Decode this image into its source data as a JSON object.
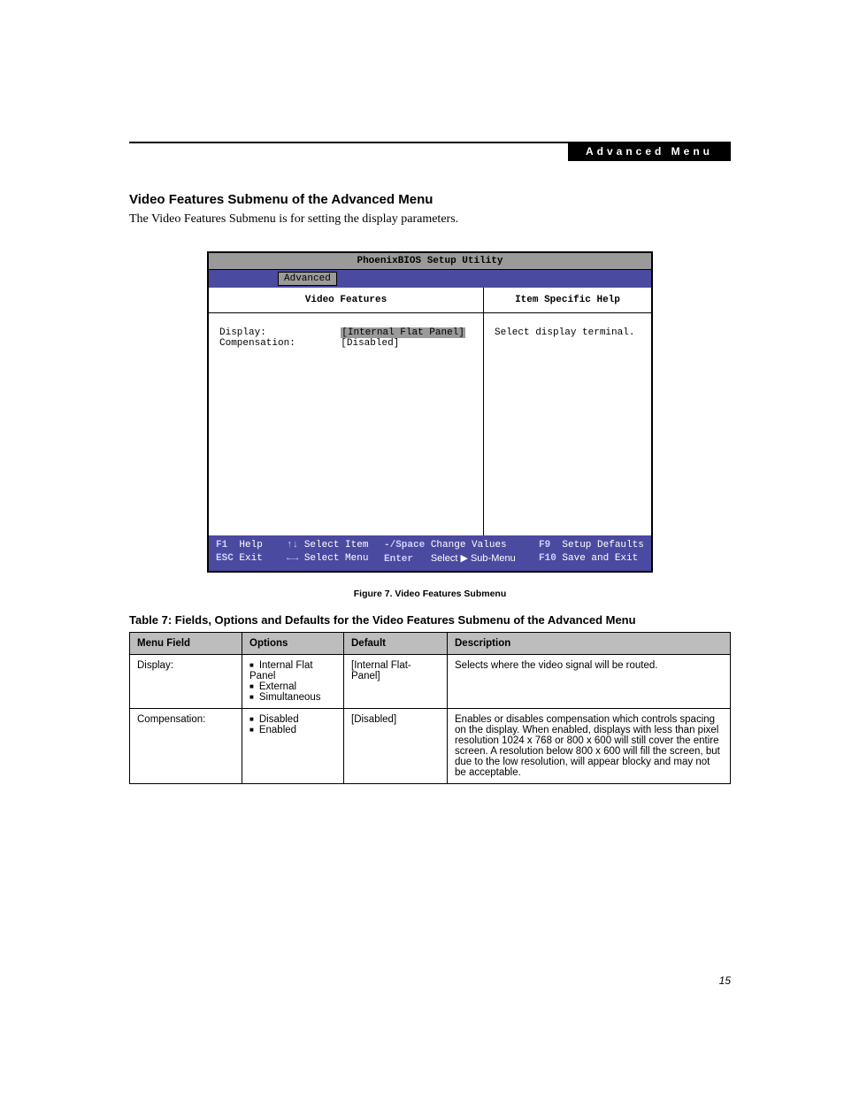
{
  "header": {
    "banner": "Advanced Menu"
  },
  "section": {
    "heading": "Video Features Submenu of the Advanced Menu",
    "intro": "The Video Features Submenu is for setting the display parameters."
  },
  "bios": {
    "title": "PhoenixBIOS Setup Utility",
    "tab": "Advanced",
    "left_heading": "Video Features",
    "right_heading": "Item Specific Help",
    "help_text": "Select display terminal.",
    "fields": {
      "display_label": "Display:",
      "display_value": "[Internal Flat Panel]",
      "compensation_label": "Compensation:",
      "compensation_value": "[Disabled]"
    },
    "footer": {
      "f1": "F1",
      "help": "Help",
      "updown": "↑↓",
      "select_item": "Select Item",
      "minus_space": "-/Space",
      "change_values": "Change Values",
      "f9": "F9",
      "setup_defaults": "Setup Defaults",
      "esc": "ESC",
      "exit": "Exit",
      "leftright": "←→",
      "select_menu": "Select Menu",
      "enter": "Enter",
      "select_submenu": "Select ▶ Sub-Menu",
      "f10": "F10",
      "save_exit": "Save and Exit"
    }
  },
  "figure_caption": "Figure 7.  Video Features Submenu",
  "table_caption": "Table 7: Fields, Options and Defaults for the Video Features Submenu of the Advanced Menu",
  "table": {
    "headers": {
      "c1": "Menu Field",
      "c2": "Options",
      "c3": "Default",
      "c4": "Description"
    },
    "rows": [
      {
        "field": "Display:",
        "options": [
          "Internal Flat Panel",
          "External",
          "Simultaneous"
        ],
        "default": "[Internal Flat-Panel]",
        "description": "Selects where the video signal will be routed."
      },
      {
        "field": "Compensation:",
        "options": [
          "Disabled",
          "Enabled"
        ],
        "default": "[Disabled]",
        "description": "Enables or disables compensation which controls spacing on the display. When enabled, displays with less than pixel resolution 1024 x 768 or 800 x 600 will still cover the entire screen. A resolution below 800 x 600 will fill the screen, but due to the low resolution, will appear blocky and may not be acceptable."
      }
    ]
  },
  "page_number": "15"
}
